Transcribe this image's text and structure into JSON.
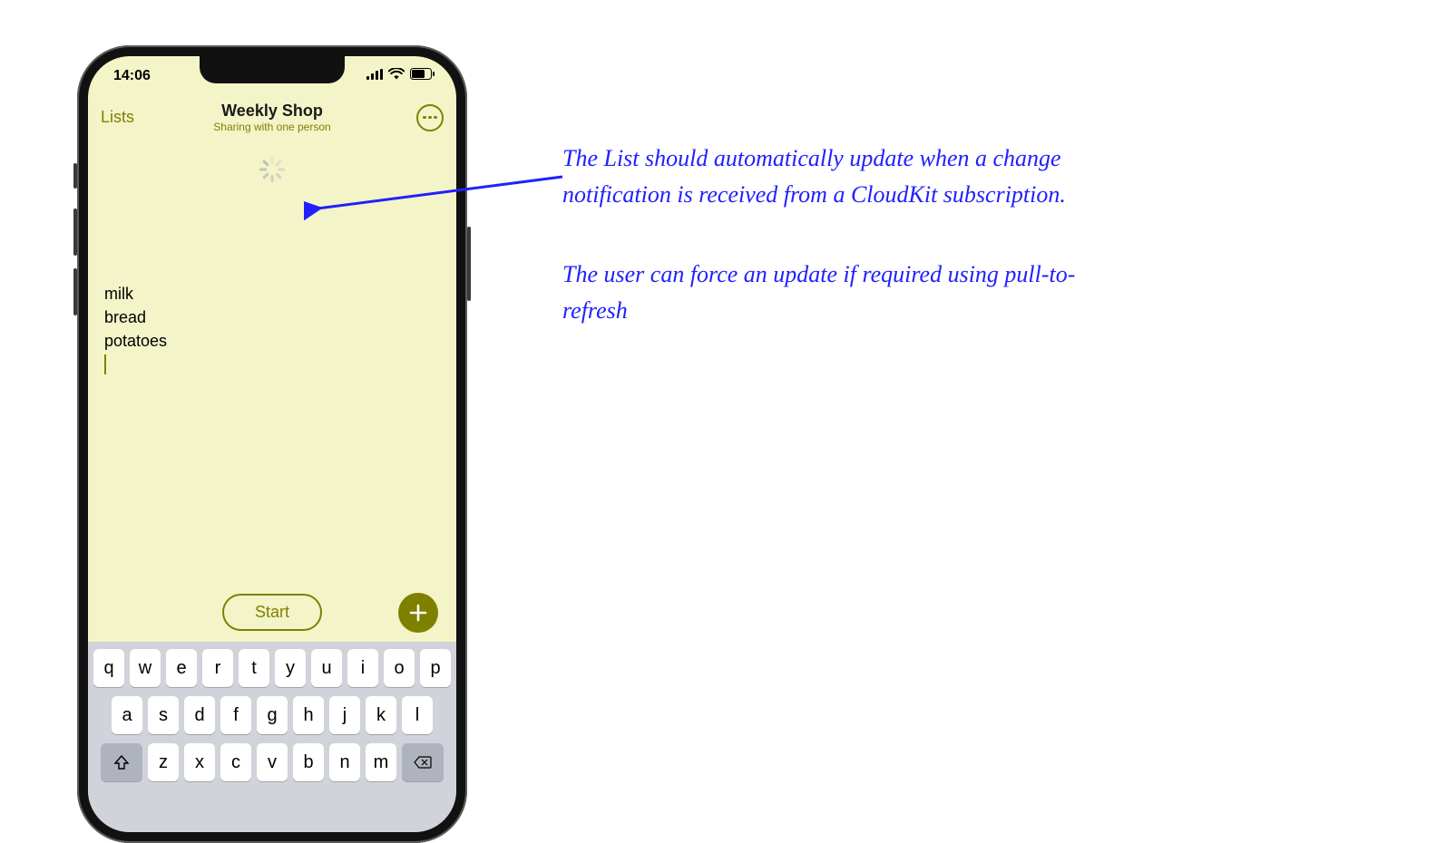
{
  "status": {
    "time": "14:06"
  },
  "nav": {
    "back_label": "Lists",
    "title": "Weekly Shop",
    "subtitle": "Sharing with one person"
  },
  "list": {
    "items": [
      "milk",
      "bread",
      "potatoes"
    ]
  },
  "actions": {
    "start_label": "Start"
  },
  "keyboard": {
    "row1": [
      "q",
      "w",
      "e",
      "r",
      "t",
      "y",
      "u",
      "i",
      "o",
      "p"
    ],
    "row2": [
      "a",
      "s",
      "d",
      "f",
      "g",
      "h",
      "j",
      "k",
      "l"
    ],
    "row3": [
      "z",
      "x",
      "c",
      "v",
      "b",
      "n",
      "m"
    ]
  },
  "annotation": {
    "p1": "The List should automatically update when a change notification is received from a CloudKit subscription.",
    "p2": "The user can force an update if required using pull-to-refresh"
  },
  "colors": {
    "accent": "#808000",
    "annot": "#2020ff"
  }
}
